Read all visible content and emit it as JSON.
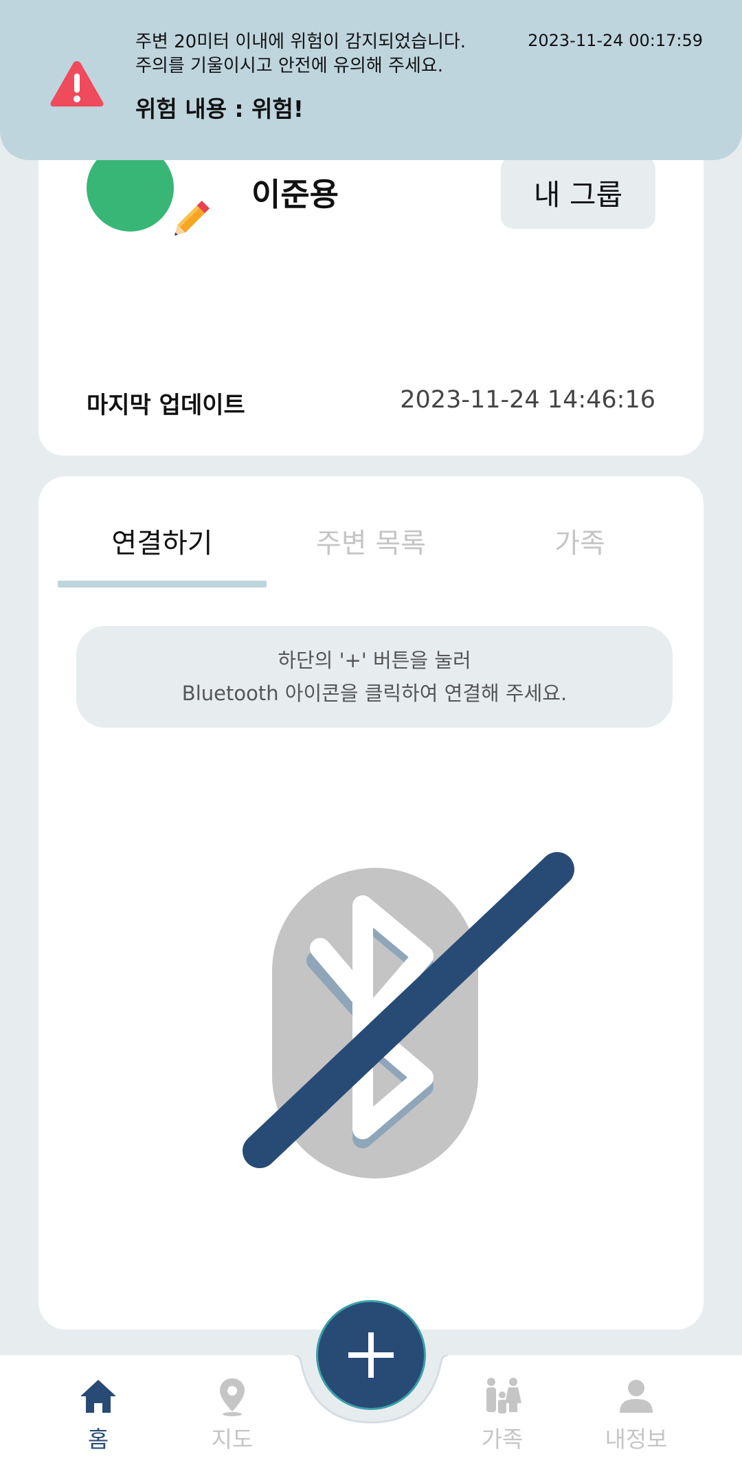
{
  "notification": {
    "message": "주변 20미터 이내에 위험이 감지되었습니다.\n주의를 기울이시고 안전에 유의해 주세요.",
    "timestamp": "2023-11-24 00:17:59",
    "danger": "위험 내용 : 위험!",
    "icon": "warning-triangle-icon",
    "accent_color": "#ef4b5c"
  },
  "profile": {
    "name": "이준용",
    "group_button": "내 그룹",
    "update_label": "마지막 업데이트",
    "update_value": "2023-11-24 14:46:16",
    "avatar_color": "#38b676"
  },
  "tabs": [
    {
      "label": "연결하기",
      "active": true
    },
    {
      "label": "주변 목록",
      "active": false
    },
    {
      "label": "가족",
      "active": false
    }
  ],
  "hint": {
    "line1": "하단의 '+' 버튼을 눌러",
    "line2": "Bluetooth 아이콘을 클릭하여 연결해 주세요."
  },
  "bluetooth_status_icon": "bluetooth-disabled-icon",
  "fab_icon": "plus-icon",
  "nav": [
    {
      "label": "홈",
      "icon": "home-icon",
      "active": true
    },
    {
      "label": "지도",
      "icon": "map-pin-icon",
      "active": false
    },
    {
      "label": "가족",
      "icon": "family-icon",
      "active": false
    },
    {
      "label": "내정보",
      "icon": "person-icon",
      "active": false
    }
  ],
  "colors": {
    "primary": "#284b75",
    "banner": "#bfd5de",
    "background": "#e7ecef"
  }
}
